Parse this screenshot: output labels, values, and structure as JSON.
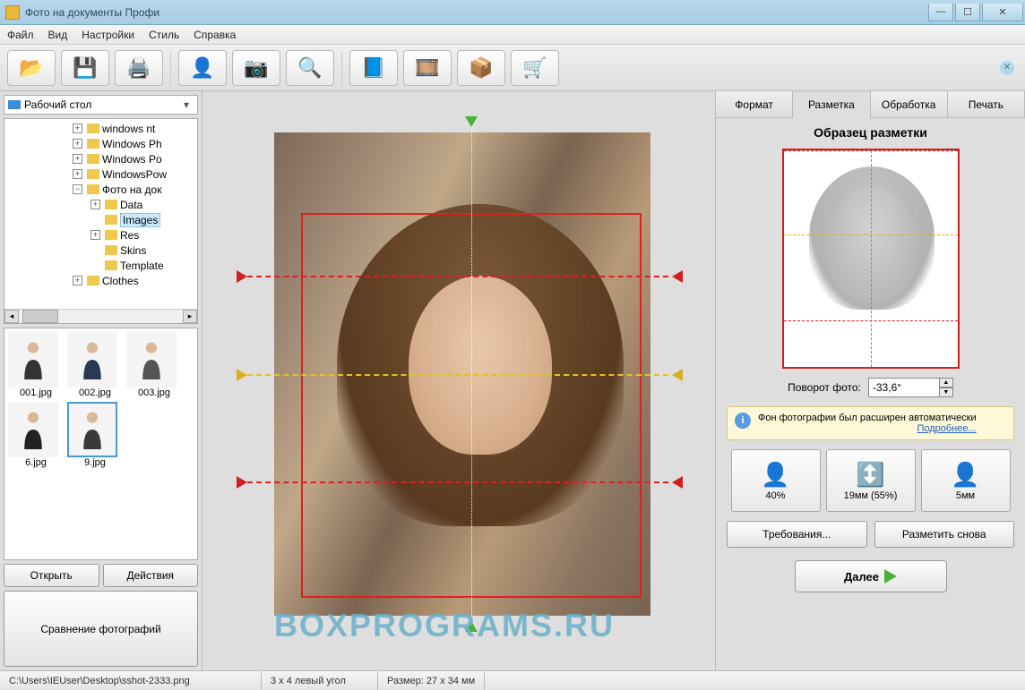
{
  "titlebar": {
    "title": "Фото на документы Профи"
  },
  "menu": {
    "file": "Файл",
    "view": "Вид",
    "settings": "Настройки",
    "style": "Стиль",
    "help": "Справка"
  },
  "left": {
    "combo": "Рабочий стол",
    "tree": {
      "n0": "windows nt",
      "n1": "Windows Ph",
      "n2": "Windows Po",
      "n3": "WindowsPow",
      "n4": "Фото на док",
      "n5": "Data",
      "n6": "Images",
      "n7": "Res",
      "n8": "Skins",
      "n9": "Template",
      "n10": "Clothes"
    },
    "thumbs": {
      "t0": "001.jpg",
      "t1": "002.jpg",
      "t2": "003.jpg",
      "t3": "6.jpg",
      "t4": "9.jpg"
    },
    "open": "Открыть",
    "actions": "Действия",
    "compare": "Сравнение фотографий"
  },
  "right": {
    "tabs": {
      "format": "Формат",
      "layout": "Разметка",
      "process": "Обработка",
      "print": "Печать"
    },
    "sample_title": "Образец разметки",
    "rot_label": "Поворот фото:",
    "rot_value": "-33,6°",
    "info_text": "Фон фотографии был расширен автоматически",
    "info_link": "Подробнее...",
    "params": {
      "p0": "40%",
      "p1": "19мм (55%)",
      "p2": "5мм"
    },
    "req_btn": "Требования...",
    "again_btn": "Разметить снова",
    "next_btn": "Далее"
  },
  "status": {
    "path": "C:\\Users\\IEUser\\Desktop\\sshot-2333.png",
    "fmt": "3 x 4 левый угол",
    "size": "Размер: 27 x 34 мм"
  },
  "watermark": "BOXPROGRAMS.RU"
}
